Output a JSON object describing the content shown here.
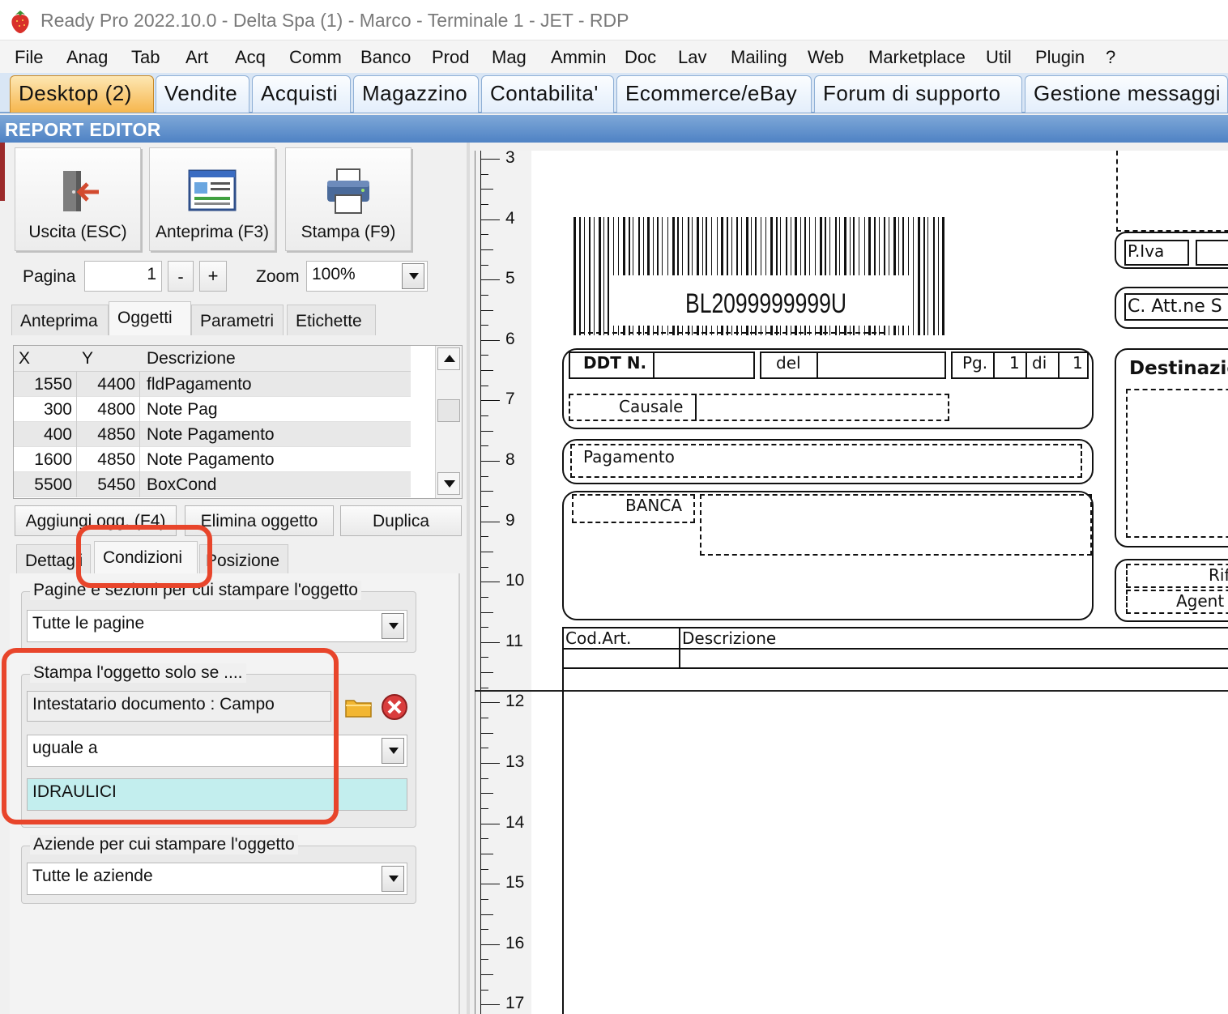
{
  "window": {
    "title": "Ready Pro 2022.10.0 - Delta Spa (1) - Marco - Terminale 1 - JET - RDP"
  },
  "menu": [
    "File",
    "Anag",
    "Tab",
    "Art",
    "Acq",
    "Comm",
    "Banco",
    "Prod",
    "Mag",
    "Ammin",
    "Doc",
    "Lav",
    "Mailing",
    "Web",
    "Marketplace",
    "Util",
    "Plugin",
    "?"
  ],
  "tabs": [
    "Desktop (2)",
    "Vendite",
    "Acquisti",
    "Magazzino",
    "Contabilita'",
    "Ecommerce/eBay",
    "Forum di supporto",
    "Gestione messaggi"
  ],
  "editor": {
    "header": "REPORT EDITOR",
    "toolbar": {
      "exit_label": "Uscita (ESC)",
      "preview_label": "Anteprima (F3)",
      "print_label": "Stampa (F9)"
    },
    "page_label": "Pagina",
    "page_value": "1",
    "minus_label": "-",
    "plus_label": "+",
    "zoom_label": "Zoom",
    "zoom_value": "100%",
    "panel_tabs": [
      "Anteprima",
      "Oggetti",
      "Parametri",
      "Etichette"
    ],
    "grid": {
      "columns": [
        "X",
        "Y",
        "Descrizione"
      ],
      "rows": [
        {
          "x": "1550",
          "y": "4400",
          "desc": "fldPagamento"
        },
        {
          "x": "300",
          "y": "4800",
          "desc": "Note Pag"
        },
        {
          "x": "400",
          "y": "4850",
          "desc": "Note Pagamento"
        },
        {
          "x": "1600",
          "y": "4850",
          "desc": "Note Pagamento"
        },
        {
          "x": "5500",
          "y": "5450",
          "desc": "BoxCond"
        }
      ]
    },
    "actions": {
      "add_label": "Aggiungi ogg. (F4)",
      "delete_label": "Elimina oggetto",
      "duplicate_label": "Duplica"
    },
    "detail_tabs": [
      "Dettagli",
      "Condizioni",
      "Posizione"
    ],
    "pages_group": {
      "title": "Pagine e sezioni per cui stampare l'oggetto",
      "value": "Tutte le pagine"
    },
    "condition_group": {
      "title": "Stampa l'oggetto solo se ....",
      "field": "Intestatario documento : Campo",
      "operator": "uguale a",
      "value": "IDRAULICI"
    },
    "companies_group": {
      "title": "Aziende per cui stampare l'oggetto",
      "value": "Tutte le aziende"
    }
  },
  "ruler": [
    "3",
    "4",
    "5",
    "6",
    "7",
    "8",
    "9",
    "10",
    "11",
    "12",
    "13",
    "14",
    "15",
    "16",
    "17"
  ],
  "report": {
    "barcode": "BL2099999999U",
    "piva": "P.Iva",
    "att": "C. Att.ne S",
    "ddt": "DDT N.",
    "del": "del",
    "pg": "Pg.",
    "pg_num": "1",
    "di": "di",
    "di_num": "1",
    "causale": "Causale",
    "destinazione": "Destinazio",
    "pagamento": "Pagamento",
    "banca": "BANCA",
    "rif": "Rif",
    "agent": "Agent",
    "cod_art": "Cod.Art.",
    "descrizione": "Descrizione"
  },
  "colors": {
    "highlight": "#e8452b",
    "active_tab": "#f6b64d",
    "header_bar": "#4f82c4",
    "condition_value_bg": "#c3eeee"
  }
}
